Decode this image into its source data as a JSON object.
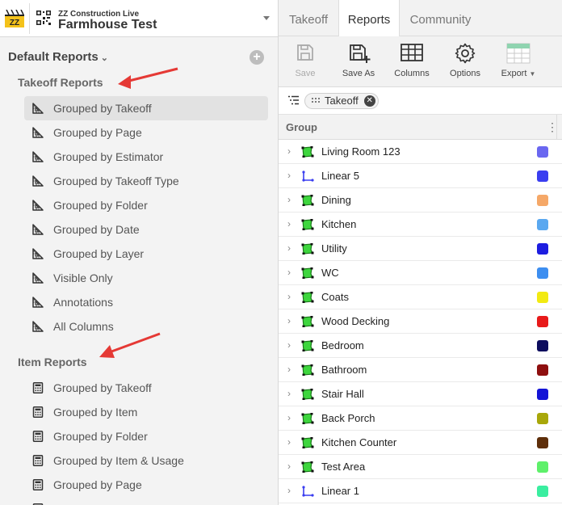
{
  "project": {
    "company": "ZZ Construction Live",
    "name": "Farmhouse Test"
  },
  "left": {
    "default_reports_label": "Default Reports",
    "add_icon": "plus-circle-icon",
    "sections": [
      {
        "title": "Takeoff Reports",
        "icon": "takeoff-report-icon",
        "items": [
          {
            "label": "Grouped by Takeoff",
            "selected": true
          },
          {
            "label": "Grouped by Page"
          },
          {
            "label": "Grouped by Estimator"
          },
          {
            "label": "Grouped by Takeoff Type"
          },
          {
            "label": "Grouped by Folder"
          },
          {
            "label": "Grouped by Date"
          },
          {
            "label": "Grouped by Layer"
          },
          {
            "label": "Visible Only"
          },
          {
            "label": "Annotations"
          },
          {
            "label": "All Columns"
          }
        ]
      },
      {
        "title": "Item Reports",
        "icon": "calculator-icon",
        "items": [
          {
            "label": "Grouped by Takeoff"
          },
          {
            "label": "Grouped by Item"
          },
          {
            "label": "Grouped by Folder"
          },
          {
            "label": "Grouped by Item & Usage"
          },
          {
            "label": "Grouped by Page"
          }
        ]
      }
    ],
    "annotation_color": "#e53935"
  },
  "tabs": [
    {
      "label": "Takeoff",
      "active": false
    },
    {
      "label": "Reports",
      "active": true
    },
    {
      "label": "Community",
      "active": false
    }
  ],
  "toolbar": [
    {
      "label": "Save",
      "icon": "save-icon",
      "disabled": true
    },
    {
      "label": "Save As",
      "icon": "save-as-icon",
      "disabled": false
    },
    {
      "label": "Columns",
      "icon": "columns-icon",
      "disabled": false
    },
    {
      "label": "Options",
      "icon": "gear-icon",
      "disabled": false
    },
    {
      "label": "Export",
      "icon": "spreadsheet-icon",
      "disabled": false
    }
  ],
  "filter": {
    "chip_label": "Takeoff"
  },
  "grid": {
    "header": "Group",
    "rows": [
      {
        "name": "Living Room 123",
        "type": "area",
        "color": "#6a67f0"
      },
      {
        "name": "Linear 5",
        "type": "linear",
        "color": "#3a3ef0"
      },
      {
        "name": "Dining",
        "type": "area",
        "color": "#f5a868"
      },
      {
        "name": "Kitchen",
        "type": "area",
        "color": "#5aa8f0"
      },
      {
        "name": "Utility",
        "type": "area",
        "color": "#1d1de0"
      },
      {
        "name": "WC",
        "type": "area",
        "color": "#3d8ef0"
      },
      {
        "name": "Coats",
        "type": "area",
        "color": "#f2ea12"
      },
      {
        "name": "Wood Decking",
        "type": "area",
        "color": "#e81a1a"
      },
      {
        "name": "Bedroom",
        "type": "area",
        "color": "#0d0d5e"
      },
      {
        "name": "Bathroom",
        "type": "area",
        "color": "#8e0f0f"
      },
      {
        "name": "Stair Hall",
        "type": "area",
        "color": "#1414d6"
      },
      {
        "name": "Back Porch",
        "type": "area",
        "color": "#a8a70a"
      },
      {
        "name": "Kitchen Counter",
        "type": "area",
        "color": "#5e2e0a"
      },
      {
        "name": "Test Area",
        "type": "area",
        "color": "#5ef06a"
      },
      {
        "name": "Linear 1",
        "type": "linear",
        "color": "#3aeea0"
      }
    ]
  }
}
